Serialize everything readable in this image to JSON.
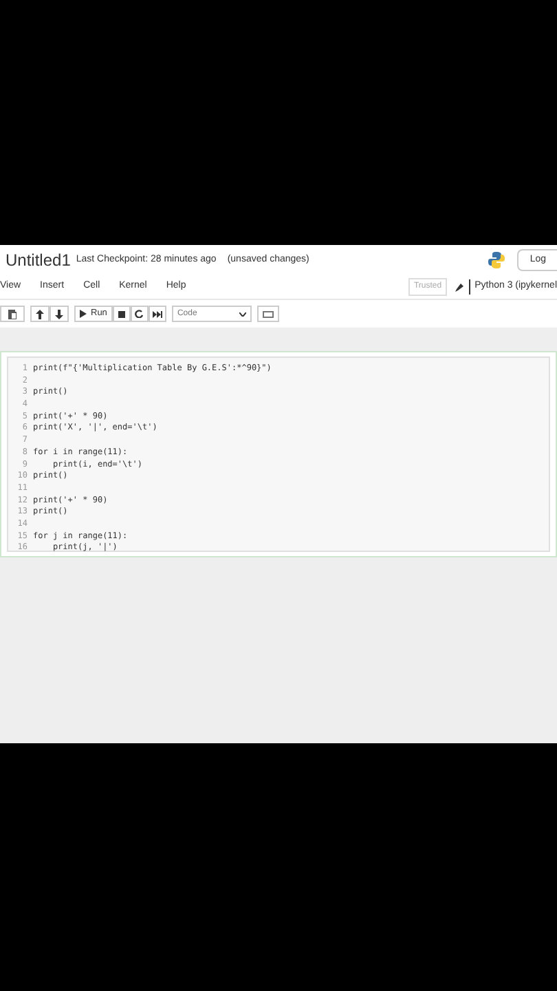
{
  "header": {
    "title": "Untitled1",
    "checkpoint": "Last Checkpoint: 28 minutes ago",
    "save_state": "(unsaved changes)",
    "login": "Log"
  },
  "menu": [
    {
      "label": "View"
    },
    {
      "label": "Insert"
    },
    {
      "label": "Cell"
    },
    {
      "label": "Kernel"
    },
    {
      "label": "Help"
    }
  ],
  "trusted": "Trusted",
  "kernel": "Python 3 (ipykernel",
  "toolbar": {
    "run": "Run",
    "cell_type": "Code"
  },
  "cell": {
    "lines": [
      {
        "number": "1",
        "code": "print(f\"{'Multiplication Table By G.E.S':*^90}\")"
      },
      {
        "number": "2"
      },
      {
        "number": "3",
        "code": "print()"
      },
      {
        "number": "4"
      },
      {
        "number": "5",
        "code": "print('+' * 90)"
      },
      {
        "number": "6",
        "code": "print('X', '|', end='\\t')"
      },
      {
        "number": "7"
      },
      {
        "number": "8",
        "code": "for i in range(11):"
      },
      {
        "number": "9",
        "code": "    print(i, end='\\t')"
      },
      {
        "number": "10",
        "code": "print()"
      },
      {
        "number": "11"
      },
      {
        "number": "12",
        "code": "print('+' * 90)"
      },
      {
        "number": "13",
        "code": "print()"
      },
      {
        "number": "14"
      },
      {
        "number": "15",
        "code": "for j in range(11):"
      },
      {
        "number": "16",
        "code": "    print(j, '|')"
      }
    ]
  }
}
